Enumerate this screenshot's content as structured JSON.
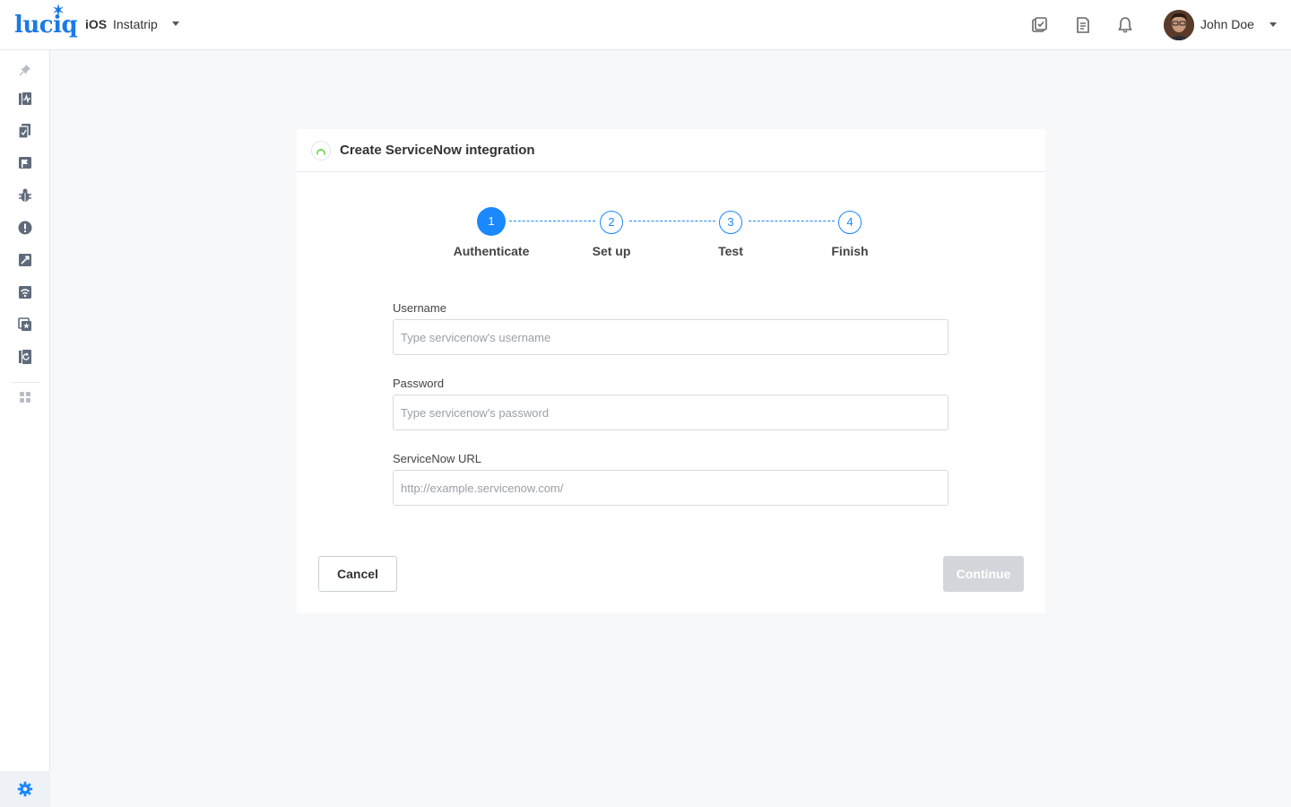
{
  "header": {
    "logo_text": "luciq",
    "platform": "iOS",
    "app_name": "Instatrip",
    "icons": [
      "tasks-icon",
      "release-notes-icon",
      "notifications-bell-icon"
    ],
    "user": {
      "name": "John Doe"
    }
  },
  "sidebar": {
    "items": [
      "pin-icon",
      "dashboard-icon",
      "reports-icon",
      "feedback-icon",
      "bugs-icon",
      "crashes-icon",
      "surveys-icon",
      "network-icon",
      "app-ratings-icon",
      "session-replay-icon",
      "apps-grid-icon"
    ],
    "settings_icon": "settings-gear-icon"
  },
  "card": {
    "title": "Create ServiceNow integration",
    "steps": [
      {
        "number": "1",
        "label": "Authenticate",
        "active": true
      },
      {
        "number": "2",
        "label": "Set up",
        "active": false
      },
      {
        "number": "3",
        "label": "Test",
        "active": false
      },
      {
        "number": "4",
        "label": "Finish",
        "active": false
      }
    ],
    "fields": {
      "username": {
        "label": "Username",
        "placeholder": "Type servicenow's username",
        "value": ""
      },
      "password": {
        "label": "Password",
        "placeholder": "Type servicenow's password",
        "value": ""
      },
      "url": {
        "label": "ServiceNow URL",
        "placeholder": "http://example.servicenow.com/",
        "value": ""
      }
    },
    "buttons": {
      "cancel": "Cancel",
      "continue": "Continue"
    }
  },
  "colors": {
    "accent": "#1a88ff",
    "brand": "#1a7ae6",
    "disabled_button": "#d3d6da",
    "page_background": "#f7f8fa"
  }
}
